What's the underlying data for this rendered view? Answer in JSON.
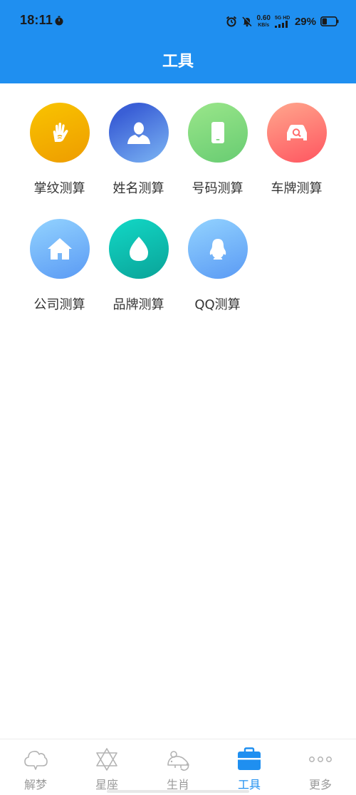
{
  "status": {
    "time": "18:11",
    "net_speed_value": "0.60",
    "net_speed_unit": "KB/s",
    "network_label": "5G HD",
    "battery": "29%"
  },
  "header": {
    "title": "工具"
  },
  "tools": [
    {
      "label": "掌纹测算",
      "icon": "palm-icon",
      "colors": [
        "#f9c200",
        "#f0a000"
      ]
    },
    {
      "label": "姓名测算",
      "icon": "person-icon",
      "colors": [
        "#3a62d8",
        "#7fb4f5"
      ]
    },
    {
      "label": "号码测算",
      "icon": "phone-icon",
      "colors": [
        "#8ee081",
        "#6ccf73"
      ]
    },
    {
      "label": "车牌测算",
      "icon": "car-icon",
      "colors": [
        "#ffa08a",
        "#ff5a63"
      ]
    },
    {
      "label": "公司测算",
      "icon": "house-icon",
      "colors": [
        "#8fd0ff",
        "#5b9df5"
      ]
    },
    {
      "label": "品牌测算",
      "icon": "drop-icon",
      "colors": [
        "#14d5c4",
        "#0aa89c"
      ]
    },
    {
      "label": "QQ测算",
      "icon": "qq-penguin-icon",
      "colors": [
        "#8fd0ff",
        "#5b9df5"
      ]
    }
  ],
  "tabbar": {
    "active": "工具",
    "items": [
      {
        "label": "解梦",
        "icon": "cloud-icon"
      },
      {
        "label": "星座",
        "icon": "star-of-david-icon"
      },
      {
        "label": "生肖",
        "icon": "rat-icon"
      },
      {
        "label": "工具",
        "icon": "toolbox-icon"
      },
      {
        "label": "更多",
        "icon": "more-dots-icon"
      }
    ]
  },
  "colors": {
    "primary": "#1f8ff0",
    "tab_inactive": "#9a9a9a",
    "text": "#333333"
  }
}
